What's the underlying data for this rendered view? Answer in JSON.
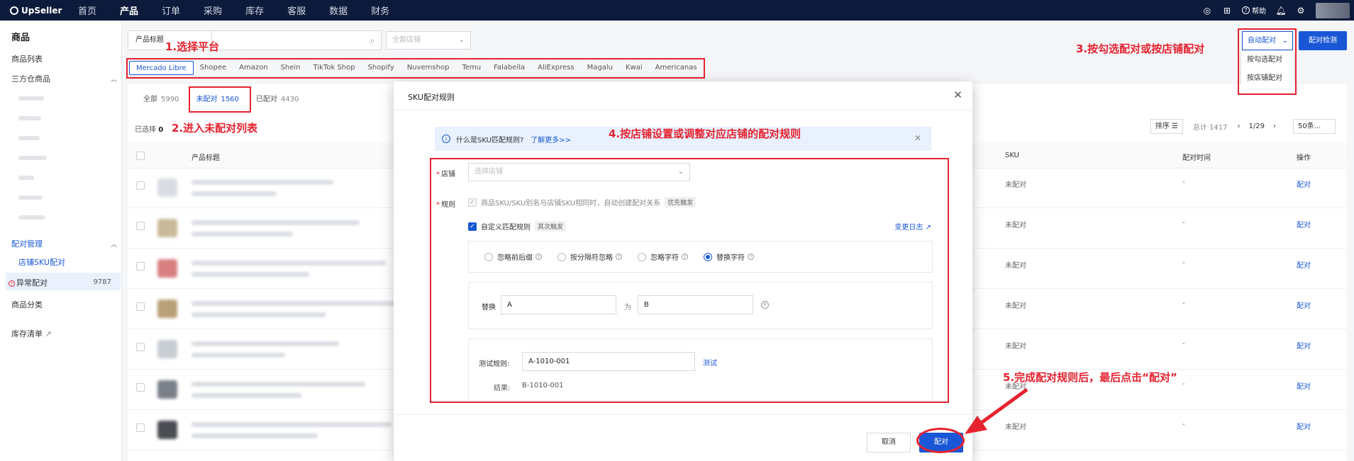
{
  "topnav": {
    "logo": "UpSeller",
    "items": [
      "首页",
      "产品",
      "订单",
      "采购",
      "库存",
      "客服",
      "数据",
      "财务"
    ],
    "active_index": 1,
    "help": "帮助"
  },
  "sidebar": {
    "title": "商品",
    "product_list": "商品列表",
    "third_party": "三方仓商品",
    "match_manage": "配对管理",
    "store_sku_match": "店铺SKU配对",
    "abnormal_match": "异常配对",
    "abnormal_count": "9787",
    "product_category": "商品分类",
    "inventory_list": "库存清单"
  },
  "toolbar": {
    "search_type": "产品标题",
    "search_placeholder": "",
    "shop_placeholder": "全部店铺",
    "auto_match": "自动配对",
    "detect": "配对检测",
    "dropdown": [
      "按勾选配对",
      "按店铺配对"
    ]
  },
  "platforms": [
    "Mercado Libre",
    "Shopee",
    "Amazon",
    "Shein",
    "TikTok Shop",
    "Shopify",
    "Nuvemshop",
    "Temu",
    "Falabella",
    "AliExpress",
    "Magalu",
    "Kwai",
    "Americanas"
  ],
  "status_tabs": [
    {
      "label": "全部",
      "count": "5990"
    },
    {
      "label": "未配对",
      "count": "1560"
    },
    {
      "label": "已配对",
      "count": "4430"
    }
  ],
  "list": {
    "selected_label": "已选择",
    "selected_count": "0",
    "sort": "排序",
    "total": "总计 1417",
    "page": "1/29",
    "page_size": "50条...",
    "headers": {
      "title": "产品标题",
      "sku": "SKU",
      "time": "配对时间",
      "action": "操作"
    },
    "rows": [
      {
        "sku": "未配对",
        "time": "-",
        "action": "配对"
      },
      {
        "sku": "未配对",
        "time": "-",
        "action": "配对"
      },
      {
        "sku": "未配对",
        "time": "-",
        "action": "配对"
      },
      {
        "sku": "未配对",
        "time": "-",
        "action": "配对"
      },
      {
        "sku": "未配对",
        "time": "-",
        "action": "配对"
      },
      {
        "sku": "未配对",
        "time": "-",
        "action": "配对"
      },
      {
        "sku": "未配对",
        "time": "-",
        "action": "配对"
      }
    ]
  },
  "modal": {
    "title": "SKU配对规则",
    "info_text": "什么是SKU匹配规则?",
    "info_link": "了解更多>>",
    "store_label": "店铺",
    "store_placeholder": "选择店铺",
    "rule_label": "规则",
    "rule1": "商品SKU/SKU别名与店铺SKU相同时，自动创建配对关系",
    "rule1_tag": "优先触发",
    "rule2": "自定义匹配规则",
    "rule2_tag": "其次触发",
    "change_log": "变更日志",
    "options": [
      "忽略前后缀",
      "按分隔符忽略",
      "忽略字符",
      "替换字符"
    ],
    "selected_option": 3,
    "replace_label": "替换",
    "replace_from": "A",
    "replace_as": "为",
    "replace_to": "B",
    "test_label": "测试规则:",
    "test_value": "A-1010-001",
    "test_link": "测试",
    "result_label": "结果:",
    "result_value": "B-1010-001",
    "cancel": "取消",
    "confirm": "配对"
  },
  "annotations": {
    "step1": "1.选择平台",
    "step2": "2.进入未配对列表",
    "step3": "3.按勾选配对或按店铺配对",
    "step4": "4.按店铺设置或调整对应店铺的配对规则",
    "step5": "5.完成配对规则后，最后点击“配对”"
  },
  "colors": {
    "accent": "#1a57d6",
    "nav_bg": "#0c1b3b",
    "annotation": "#e5222f"
  }
}
